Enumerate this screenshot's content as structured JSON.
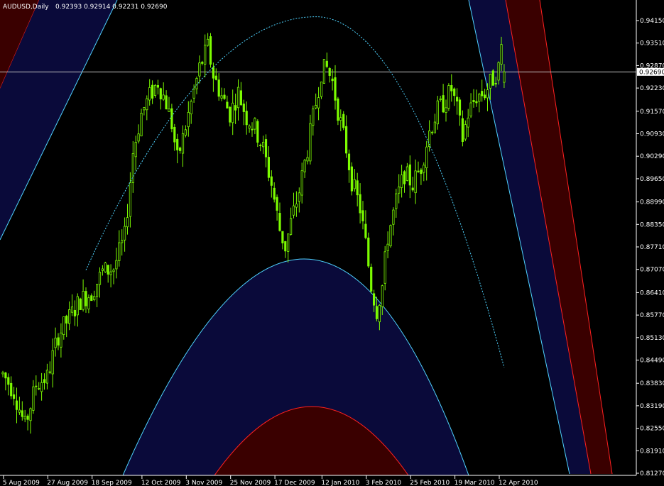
{
  "header": {
    "symbol": "AUDUSD,Daily",
    "values": "0.92393 0.92914 0.92231 0.92690"
  },
  "colors": {
    "background": "#000000",
    "candles": "#7CFC00",
    "channel_fill_blue": "#0a0a3a",
    "channel_edge_cyan": "#4fd3ff",
    "channel_fill_red": "#3a0000",
    "channel_edge_red": "#ff2020",
    "projection_dotted": "#4fd3ff",
    "current_price_line": "#c0c0c0",
    "axis": "#ffffff"
  },
  "chart_data": {
    "type": "candlestick",
    "symbol": "AUDUSD",
    "timeframe": "Daily",
    "current_price": 0.9269,
    "current_price_label": "0.92690",
    "y_ticks": [
      {
        "value": 0.9415,
        "label": "0.94150"
      },
      {
        "value": 0.9351,
        "label": "0.93510"
      },
      {
        "value": 0.9287,
        "label": "0.92870"
      },
      {
        "value": 0.9223,
        "label": "0.92230"
      },
      {
        "value": 0.9157,
        "label": "0.91570"
      },
      {
        "value": 0.9093,
        "label": "0.90930"
      },
      {
        "value": 0.9029,
        "label": "0.90290"
      },
      {
        "value": 0.8965,
        "label": "0.89650"
      },
      {
        "value": 0.8899,
        "label": "0.88990"
      },
      {
        "value": 0.8835,
        "label": "0.88350"
      },
      {
        "value": 0.8771,
        "label": "0.87710"
      },
      {
        "value": 0.8707,
        "label": "0.87070"
      },
      {
        "value": 0.8641,
        "label": "0.86410"
      },
      {
        "value": 0.8577,
        "label": "0.85770"
      },
      {
        "value": 0.8513,
        "label": "0.85130"
      },
      {
        "value": 0.8449,
        "label": "0.84490"
      },
      {
        "value": 0.8383,
        "label": "0.83830"
      },
      {
        "value": 0.8319,
        "label": "0.83190"
      },
      {
        "value": 0.8255,
        "label": "0.82550"
      },
      {
        "value": 0.8191,
        "label": "0.81910"
      },
      {
        "value": 0.8127,
        "label": "0.81270"
      }
    ],
    "x_ticks": [
      {
        "index": 1,
        "label": "5 Aug 2009"
      },
      {
        "index": 17,
        "label": "27 Aug 2009"
      },
      {
        "index": 33,
        "label": "18 Sep 2009"
      },
      {
        "index": 51,
        "label": "12 Oct 2009"
      },
      {
        "index": 67,
        "label": "3 Nov 2009"
      },
      {
        "index": 83,
        "label": "25 Nov 2009"
      },
      {
        "index": 99,
        "label": "17 Dec 2009"
      },
      {
        "index": 116,
        "label": "12 Jan 2010"
      },
      {
        "index": 132,
        "label": "3 Feb 2010"
      },
      {
        "index": 148,
        "label": "25 Feb 2010"
      },
      {
        "index": 164,
        "label": "19 Mar 2010"
      },
      {
        "index": 180,
        "label": "12 Apr 2010"
      }
    ],
    "close_path": [
      [
        0,
        0.841
      ],
      [
        4,
        0.836
      ],
      [
        8,
        0.826
      ],
      [
        12,
        0.838
      ],
      [
        16,
        0.84
      ],
      [
        20,
        0.852
      ],
      [
        24,
        0.857
      ],
      [
        28,
        0.862
      ],
      [
        32,
        0.864
      ],
      [
        36,
        0.87
      ],
      [
        40,
        0.871
      ],
      [
        44,
        0.88
      ],
      [
        47,
        0.904
      ],
      [
        50,
        0.915
      ],
      [
        53,
        0.92
      ],
      [
        56,
        0.924
      ],
      [
        59,
        0.918
      ],
      [
        61,
        0.912
      ],
      [
        63,
        0.902
      ],
      [
        65,
        0.908
      ],
      [
        68,
        0.918
      ],
      [
        71,
        0.928
      ],
      [
        74,
        0.934
      ],
      [
        76,
        0.926
      ],
      [
        79,
        0.92
      ],
      [
        82,
        0.915
      ],
      [
        85,
        0.921
      ],
      [
        88,
        0.914
      ],
      [
        91,
        0.911
      ],
      [
        94,
        0.905
      ],
      [
        97,
        0.895
      ],
      [
        100,
        0.882
      ],
      [
        102,
        0.877
      ],
      [
        104,
        0.884
      ],
      [
        107,
        0.893
      ],
      [
        110,
        0.905
      ],
      [
        113,
        0.918
      ],
      [
        115,
        0.927
      ],
      [
        117,
        0.928
      ],
      [
        119,
        0.924
      ],
      [
        121,
        0.916
      ],
      [
        124,
        0.905
      ],
      [
        126,
        0.896
      ],
      [
        129,
        0.888
      ],
      [
        131,
        0.878
      ],
      [
        133,
        0.866
      ],
      [
        135,
        0.859
      ],
      [
        137,
        0.866
      ],
      [
        139,
        0.88
      ],
      [
        142,
        0.89
      ],
      [
        145,
        0.898
      ],
      [
        148,
        0.895
      ],
      [
        151,
        0.9
      ],
      [
        154,
        0.91
      ],
      [
        157,
        0.916
      ],
      [
        160,
        0.919
      ],
      [
        162,
        0.922
      ],
      [
        164,
        0.916
      ],
      [
        166,
        0.908
      ],
      [
        168,
        0.915
      ],
      [
        171,
        0.92
      ],
      [
        174,
        0.921
      ],
      [
        177,
        0.925
      ],
      [
        179,
        0.928
      ],
      [
        180,
        0.934
      ],
      [
        181,
        0.9269
      ]
    ],
    "projection_arc": {
      "start_index": 30,
      "peak_index": 113,
      "peak_value": 0.9426,
      "end_index": 181,
      "end_value": 0.8428
    },
    "lower_blue_arc": {
      "left_x": 173,
      "peak_x": 440,
      "peak_y": 365,
      "right_x": 660
    },
    "lower_red_arc": {
      "left_x": 302,
      "peak_x": 440,
      "peak_y": 573,
      "right_x": 575
    }
  }
}
